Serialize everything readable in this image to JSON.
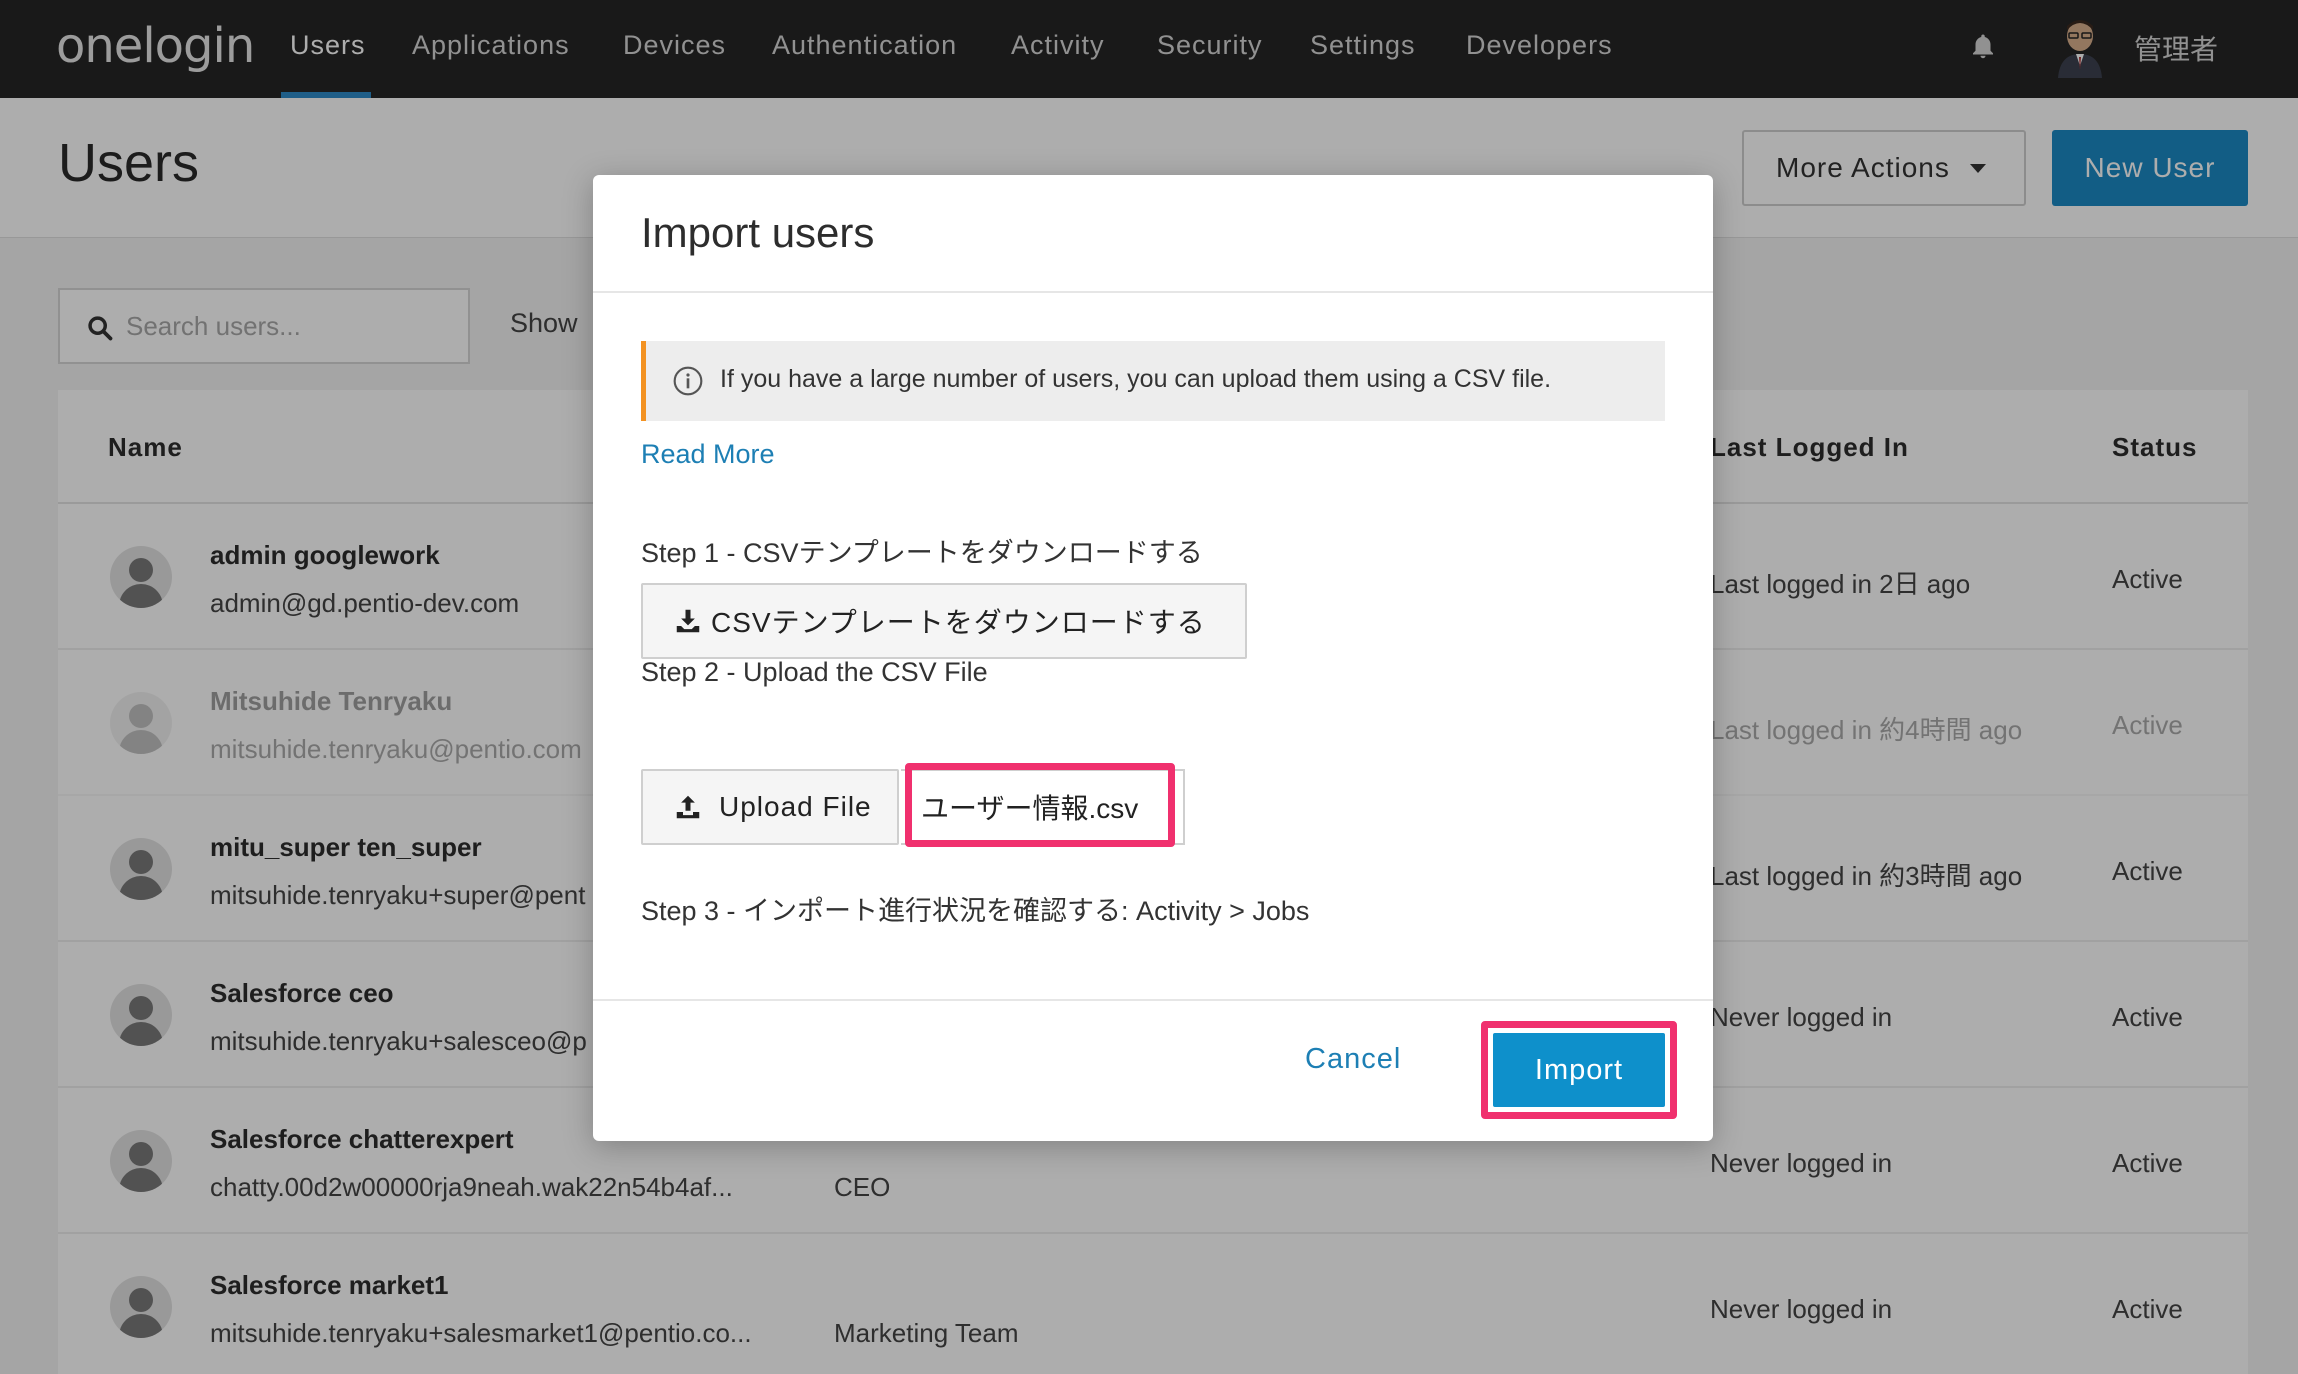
{
  "nav": {
    "logo": "onelogin",
    "items": [
      {
        "label": "Users",
        "active": true
      },
      {
        "label": "Applications"
      },
      {
        "label": "Devices"
      },
      {
        "label": "Authentication"
      },
      {
        "label": "Activity"
      },
      {
        "label": "Security"
      },
      {
        "label": "Settings"
      },
      {
        "label": "Developers"
      }
    ],
    "user_name": "管理者",
    "bell_icon": "bell-icon"
  },
  "page": {
    "title": "Users",
    "more_actions_label": "More Actions",
    "new_user_label": "New User"
  },
  "search": {
    "placeholder": "Search users...",
    "value": ""
  },
  "filters": {
    "show_label": "Show"
  },
  "table": {
    "columns": [
      "Name",
      "Last Logged In",
      "Status"
    ],
    "rows": [
      {
        "name": "admin googlework",
        "email": "admin@gd.pentio-dev.com",
        "department": "",
        "last_logged": "Last logged in 2日 ago",
        "status": "Active"
      },
      {
        "name": "Mitsuhide Tenryaku",
        "email": "mitsuhide.tenryaku@pentio.com",
        "department": "",
        "last_logged": "Last logged in 約4時間 ago",
        "status": "Active"
      },
      {
        "name": "mitu_super ten_super",
        "email": "mitsuhide.tenryaku+super@pent",
        "department": "",
        "last_logged": "Last logged in 約3時間 ago",
        "status": "Active"
      },
      {
        "name": "Salesforce ceo",
        "email": "mitsuhide.tenryaku+salesceo@p",
        "department": "",
        "last_logged": "Never logged in",
        "status": "Active"
      },
      {
        "name": "Salesforce chatterexpert",
        "email": "chatty.00d2w00000rja9neah.wak22n54b4af...",
        "department": "CEO",
        "last_logged": "Never logged in",
        "status": "Active"
      },
      {
        "name": "Salesforce market1",
        "email": "mitsuhide.tenryaku+salesmarket1@pentio.co...",
        "department": "Marketing Team",
        "last_logged": "Never logged in",
        "status": "Active"
      }
    ]
  },
  "modal": {
    "title": "Import users",
    "info_text": "If you have a large number of users, you can upload them using a CSV file.",
    "read_more": "Read More",
    "step1": "Step 1 - CSVテンプレートをダウンロードする",
    "download_button": "CSVテンプレートをダウンロードする",
    "step2": "Step 2 - Upload the CSV File",
    "upload_button": "Upload File",
    "file_name": "ユーザー情報.csv",
    "step3": "Step 3 - インポート進行状況を確認する: Activity > Jobs",
    "cancel": "Cancel",
    "import": "Import"
  },
  "colors": {
    "nav_bg": "#262626",
    "accent_blue": "#0e90cb",
    "link_blue": "#1d7fb4",
    "highlight_pink": "#f0306e",
    "info_border": "#f39222"
  }
}
